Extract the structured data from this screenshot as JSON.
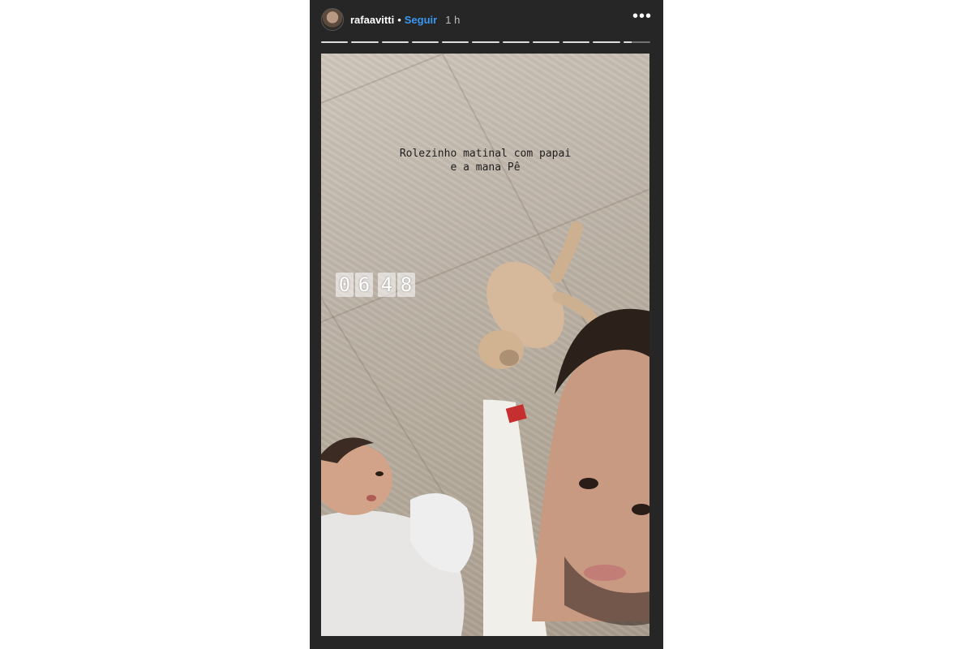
{
  "story": {
    "username": "rafaavitti",
    "separator": "•",
    "follow_label": "Seguir",
    "time_ago": "1 h",
    "more_label": "•••",
    "segments_total": 11,
    "segments_viewed": 10
  },
  "media": {
    "caption": "Rolezinho matinal com papai\ne a mana Pê",
    "clock_digits": [
      "0",
      "6",
      "4",
      "8"
    ]
  },
  "icons": {
    "avatar": "user-avatar-icon",
    "more": "more-options-icon"
  },
  "colors": {
    "background": "#262626",
    "follow": "#3897f0"
  }
}
